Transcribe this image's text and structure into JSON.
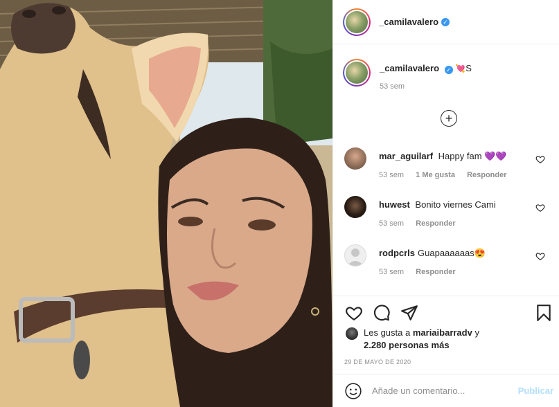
{
  "post": {
    "username": "_camilavalero",
    "verified_mark": "✓"
  },
  "caption": {
    "username": "_camilavalero",
    "emoji": "💘",
    "text": "S",
    "time": "53 sem"
  },
  "comments": [
    {
      "username": "mar_aguilarf",
      "text": "Happy fam",
      "emoji": "💜💜",
      "time": "53 sem",
      "likes": "1 Me gusta",
      "reply": "Responder"
    },
    {
      "username": "huwest",
      "text": "Bonito viernes Cami",
      "emoji": "",
      "time": "53 sem",
      "reply": "Responder"
    },
    {
      "username": "rodpcrls",
      "text": "Guapaaaaaas",
      "emoji": "😍",
      "time": "53 sem",
      "reply": "Responder"
    }
  ],
  "likes": {
    "prefix": "Les gusta a",
    "user": "mariaibarradv",
    "connector": "y",
    "others": "2.280 personas más"
  },
  "date": "29 DE MAYO DE 2020",
  "add_comment": {
    "placeholder": "Añade un comentario...",
    "publish": "Publicar"
  },
  "icons": {
    "like": "heart-icon",
    "comment": "comment-icon",
    "share": "share-icon",
    "save": "bookmark-icon",
    "load_more": "plus-circle-icon",
    "emoji": "smiley-icon"
  },
  "colors": {
    "verified": "#3897f0",
    "muted": "#8e8e8e",
    "publish_disabled": "#b2dffc"
  }
}
